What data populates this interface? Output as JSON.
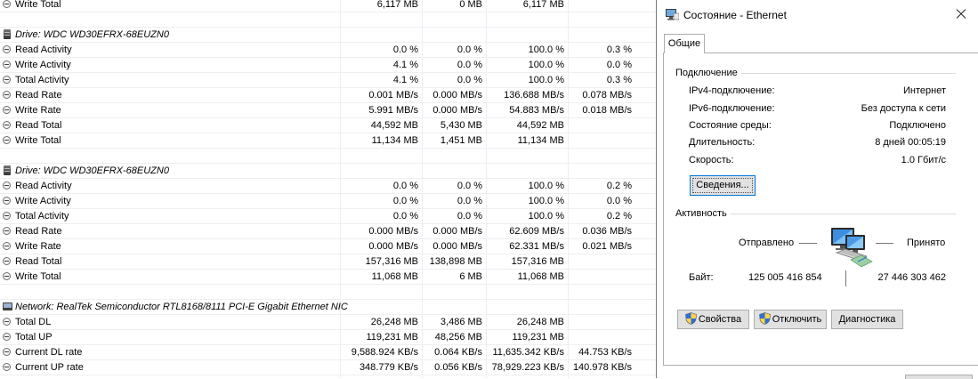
{
  "sensor_rows": [
    {
      "kind": "item",
      "label": "Write Total",
      "v1": "6,117 MB",
      "v2": "0 MB",
      "v3": "6,117 MB",
      "v4": ""
    },
    {
      "kind": "blank"
    },
    {
      "kind": "drive",
      "label": "Drive: WDC WD30EFRX-68EUZN0"
    },
    {
      "kind": "item",
      "label": "Read Activity",
      "v1": "0.0 %",
      "v2": "0.0 %",
      "v3": "100.0 %",
      "v4": "0.3 %"
    },
    {
      "kind": "item",
      "label": "Write Activity",
      "v1": "4.1 %",
      "v2": "0.0 %",
      "v3": "100.0 %",
      "v4": "0.0 %"
    },
    {
      "kind": "item",
      "label": "Total Activity",
      "v1": "4.1 %",
      "v2": "0.0 %",
      "v3": "100.0 %",
      "v4": "0.3 %"
    },
    {
      "kind": "item",
      "label": "Read Rate",
      "v1": "0.001 MB/s",
      "v2": "0.000 MB/s",
      "v3": "136.688 MB/s",
      "v4": "0.078 MB/s"
    },
    {
      "kind": "item",
      "label": "Write Rate",
      "v1": "5.991 MB/s",
      "v2": "0.000 MB/s",
      "v3": "54.883 MB/s",
      "v4": "0.018 MB/s"
    },
    {
      "kind": "item",
      "label": "Read Total",
      "v1": "44,592 MB",
      "v2": "5,430 MB",
      "v3": "44,592 MB",
      "v4": ""
    },
    {
      "kind": "item",
      "label": "Write Total",
      "v1": "11,134 MB",
      "v2": "1,451 MB",
      "v3": "11,134 MB",
      "v4": ""
    },
    {
      "kind": "blank"
    },
    {
      "kind": "drive",
      "label": "Drive: WDC WD30EFRX-68EUZN0"
    },
    {
      "kind": "item",
      "label": "Read Activity",
      "v1": "0.0 %",
      "v2": "0.0 %",
      "v3": "100.0 %",
      "v4": "0.2 %"
    },
    {
      "kind": "item",
      "label": "Write Activity",
      "v1": "0.0 %",
      "v2": "0.0 %",
      "v3": "100.0 %",
      "v4": "0.0 %"
    },
    {
      "kind": "item",
      "label": "Total Activity",
      "v1": "0.0 %",
      "v2": "0.0 %",
      "v3": "100.0 %",
      "v4": "0.2 %"
    },
    {
      "kind": "item",
      "label": "Read Rate",
      "v1": "0.000 MB/s",
      "v2": "0.000 MB/s",
      "v3": "62.609 MB/s",
      "v4": "0.036 MB/s"
    },
    {
      "kind": "item",
      "label": "Write Rate",
      "v1": "0.000 MB/s",
      "v2": "0.000 MB/s",
      "v3": "62.331 MB/s",
      "v4": "0.021 MB/s"
    },
    {
      "kind": "item",
      "label": "Read Total",
      "v1": "157,316 MB",
      "v2": "138,898 MB",
      "v3": "157,316 MB",
      "v4": ""
    },
    {
      "kind": "item",
      "label": "Write Total",
      "v1": "11,068 MB",
      "v2": "6 MB",
      "v3": "11,068 MB",
      "v4": ""
    },
    {
      "kind": "blank"
    },
    {
      "kind": "network",
      "label": "Network: RealTek Semiconductor RTL8168/8111 PCI-E Gigabit Ethernet NIC"
    },
    {
      "kind": "item",
      "label": "Total DL",
      "v1": "26,248 MB",
      "v2": "3,486 MB",
      "v3": "26,248 MB",
      "v4": ""
    },
    {
      "kind": "item",
      "label": "Total UP",
      "v1": "119,231 MB",
      "v2": "48,256 MB",
      "v3": "119,231 MB",
      "v4": ""
    },
    {
      "kind": "item",
      "label": "Current DL rate",
      "v1": "9,588.924 KB/s",
      "v2": "0.064 KB/s",
      "v3": "11,635.342 KB/s",
      "v4": "44.753 KB/s"
    },
    {
      "kind": "item",
      "label": "Current UP rate",
      "v1": "348.779 KB/s",
      "v2": "0.056 KB/s",
      "v3": "78,929.223 KB/s",
      "v4": "140.978 KB/s"
    }
  ],
  "dialog": {
    "title": "Состояние - Ethernet",
    "tab": "Общие",
    "connection": {
      "heading": "Подключение",
      "rows": [
        {
          "label": "IPv4-подключение:",
          "value": "Интернет"
        },
        {
          "label": "IPv6-подключение:",
          "value": "Без доступа к сети"
        },
        {
          "label": "Состояние среды:",
          "value": "Подключено"
        },
        {
          "label": "Длительность:",
          "value": "8 дней 00:05:19"
        },
        {
          "label": "Скорость:",
          "value": "1.0 Гбит/с"
        }
      ],
      "details_button": "Сведения..."
    },
    "activity": {
      "heading": "Активность",
      "sent_label": "Отправлено",
      "received_label": "Принято",
      "bytes_label": "Байт:",
      "bytes_sent": "125 005 416 854",
      "bytes_received": "27 446 303 462"
    },
    "buttons": {
      "properties": "Свойства",
      "disable": "Отключить",
      "diagnose": "Диагностика"
    }
  }
}
